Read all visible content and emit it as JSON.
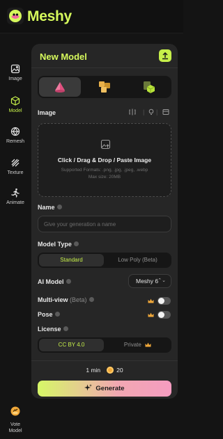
{
  "app": {
    "name": "Meshy"
  },
  "sidebar": {
    "items": [
      {
        "label": "Image",
        "icon": "image-icon",
        "active": false
      },
      {
        "label": "Model",
        "icon": "cube-icon",
        "active": true
      },
      {
        "label": "Remesh",
        "icon": "remesh-icon",
        "active": false
      },
      {
        "label": "Texture",
        "icon": "texture-icon",
        "active": false
      },
      {
        "label": "Animate",
        "icon": "running-figure-icon",
        "active": false
      }
    ],
    "vote": {
      "line1": "Vote",
      "line2": "Model",
      "icon": "vote-icon"
    }
  },
  "panel": {
    "title": "New Model",
    "export_icon": "upload-icon",
    "modes": [
      {
        "icon": "image-to-3d-mode-icon",
        "active": true
      },
      {
        "icon": "multi-image-mode-icon",
        "active": false
      },
      {
        "icon": "text-to-3d-mode-icon",
        "active": false
      }
    ],
    "image": {
      "label": "Image",
      "tools": [
        "compare-icon",
        "bulb-icon",
        "folder-icon"
      ],
      "dropzone": {
        "title": "Click / Drag & Drop / Paste Image",
        "formats": "Supported Formats: .png, .jpg, .jpeg, .webp",
        "max_size": "Max size: 20MB"
      }
    },
    "name": {
      "label": "Name",
      "placeholder": "Give your generation a name",
      "value": ""
    },
    "model_type": {
      "label": "Model Type",
      "options": [
        "Standard",
        "Low Poly (Beta)"
      ],
      "selected": "Standard"
    },
    "ai_model": {
      "label": "AI Model",
      "value": "Meshy 6",
      "caret": "⌃⌄"
    },
    "multiview": {
      "label": "Multi-view",
      "tag": "(Beta)",
      "enabled": false
    },
    "pose": {
      "label": "Pose",
      "enabled": false
    },
    "license": {
      "label": "License",
      "options": [
        "CC BY 4.0",
        "Private"
      ],
      "selected": "CC BY 4.0"
    },
    "footer": {
      "time": "1 min",
      "credits": "20",
      "generate_label": "Generate"
    }
  },
  "colors": {
    "accent": "#c6ef4a",
    "brand": "#d6f95c",
    "crown": "#f0a83a",
    "panel_bg": "#262626",
    "page_bg": "#141414"
  }
}
